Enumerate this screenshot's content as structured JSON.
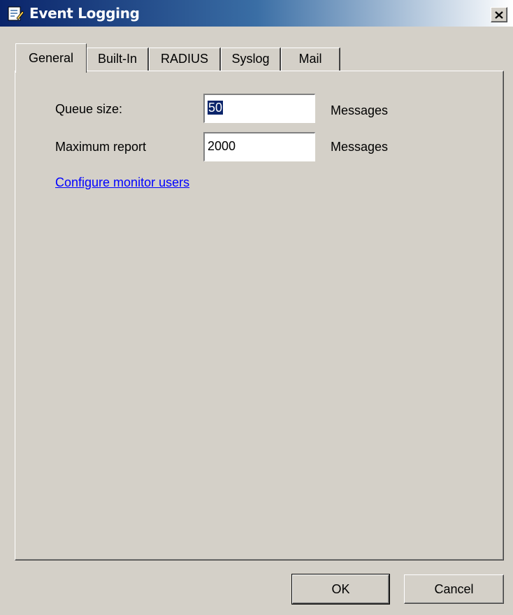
{
  "window": {
    "title": "Event Logging",
    "title_icon": "notepad-edit-icon",
    "close_icon": "close-icon"
  },
  "tabs": [
    {
      "label": "General",
      "active": true
    },
    {
      "label": "Built-In",
      "active": false
    },
    {
      "label": "RADIUS",
      "active": false
    },
    {
      "label": "Syslog",
      "active": false
    },
    {
      "label": "Mail",
      "active": false
    }
  ],
  "general": {
    "queue_size": {
      "label": "Queue size:",
      "value": "50",
      "unit": "Messages"
    },
    "maximum_report": {
      "label": "Maximum report",
      "value": "2000",
      "unit": "Messages"
    },
    "configure_link": "Configure monitor users"
  },
  "buttons": {
    "ok": "OK",
    "cancel": "Cancel"
  },
  "colors": {
    "title_start": "#0a246a",
    "face": "#d4d0c8",
    "link": "#0000ff",
    "selection": "#0a246a"
  }
}
